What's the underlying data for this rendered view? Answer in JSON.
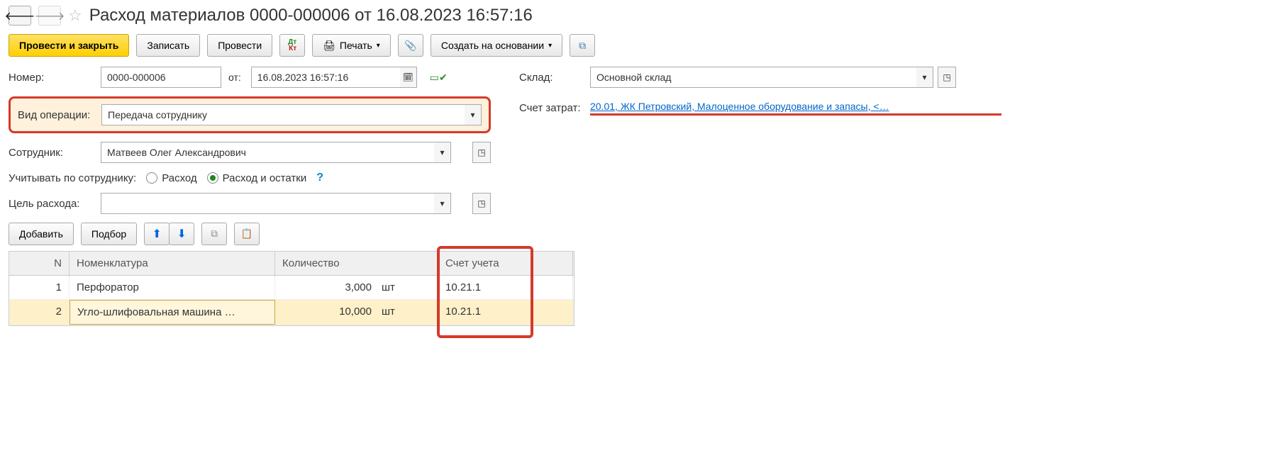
{
  "header": {
    "title": "Расход материалов 0000-000006 от 16.08.2023 16:57:16"
  },
  "toolbar": {
    "post_close": "Провести и закрыть",
    "save": "Записать",
    "post": "Провести",
    "print": "Печать",
    "create_based": "Создать на основании"
  },
  "fields": {
    "number_label": "Номер:",
    "number_value": "0000-000006",
    "date_label": "от:",
    "date_value": "16.08.2023 16:57:16",
    "warehouse_label": "Склад:",
    "warehouse_value": "Основной склад",
    "operation_type_label": "Вид операции:",
    "operation_type_value": "Передача сотруднику",
    "cost_account_label": "Счет затрат:",
    "cost_account_value": "20.01, ЖК Петровский, Малоценное оборудование и запасы, <…",
    "employee_label": "Сотрудник:",
    "employee_value": "Матвеев Олег Александрович",
    "account_by_label": "Учитывать по сотруднику:",
    "radio_expense": "Расход",
    "radio_expense_balance": "Расход и остатки",
    "purpose_label": "Цель расхода:",
    "purpose_value": ""
  },
  "table_toolbar": {
    "add": "Добавить",
    "select": "Подбор"
  },
  "grid": {
    "columns": {
      "n": "N",
      "nomen": "Номенклатура",
      "qty": "Количество",
      "acct": "Счет учета"
    },
    "rows": [
      {
        "n": "1",
        "nomen": "Перфоратор",
        "qty": "3,000",
        "unit": "шт",
        "acct": "10.21.1",
        "selected": false
      },
      {
        "n": "2",
        "nomen": "Угло-шлифовальная машина …",
        "qty": "10,000",
        "unit": "шт",
        "acct": "10.21.1",
        "selected": true
      }
    ]
  }
}
